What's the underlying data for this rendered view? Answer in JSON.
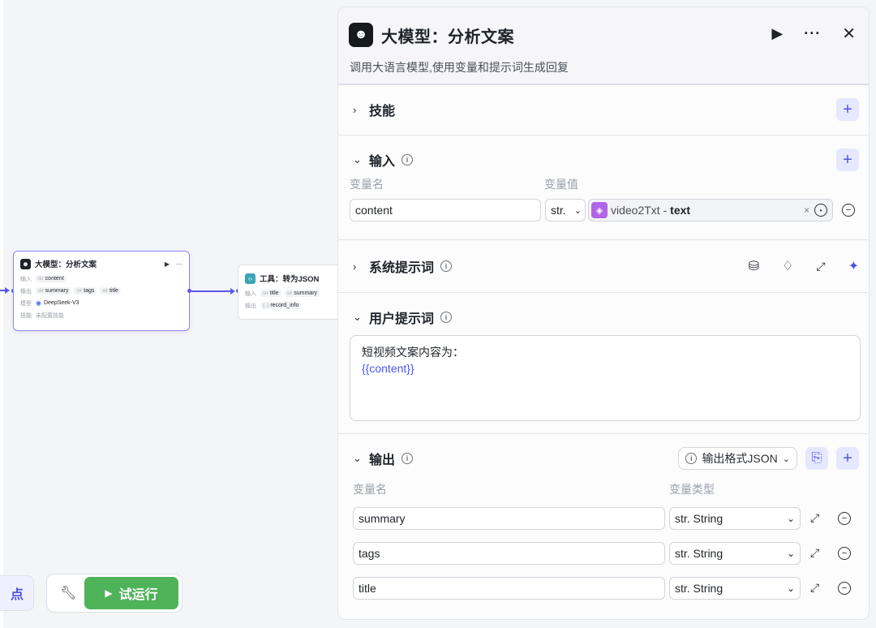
{
  "canvas": {
    "llm_node": {
      "title": "大模型：分析文案",
      "run_icon": "▶",
      "more_icon": "···",
      "input_key": "输入",
      "input_chip": {
        "type": "str",
        "name": "content"
      },
      "output_key": "输出",
      "output_chips": [
        {
          "type": "str",
          "name": "summary"
        },
        {
          "type": "str",
          "name": "tags"
        },
        {
          "type": "str",
          "name": "title"
        }
      ],
      "model_key": "模型",
      "model_value": "DeepSeek-V3",
      "skill_key": "技能",
      "skill_value": "未配置技能"
    },
    "tool_node": {
      "title": "工具：转为JSON",
      "input_key": "输入",
      "input_chips": [
        {
          "type": "str",
          "name": "title"
        },
        {
          "type": "str",
          "name": "summary"
        }
      ],
      "output_key": "输出",
      "output_chip": {
        "type": "{..}",
        "name": "record_info"
      }
    },
    "toolbar": {
      "add_node_fragment": "点",
      "run_label": "试运行",
      "run_icon": "▶"
    }
  },
  "panel": {
    "title": "大模型：分析文案",
    "description": "调用大语言模型,使用变量和提示词生成回复",
    "sections": {
      "skills": {
        "name": "技能"
      },
      "input": {
        "name": "输入",
        "col_name": "变量名",
        "col_value": "变量值",
        "rows": [
          {
            "name": "content",
            "type": "str.",
            "ref_node": "video2Txt",
            "ref_sep": " - ",
            "ref_field": "text"
          }
        ]
      },
      "system_prompt": {
        "name": "系统提示词"
      },
      "user_prompt": {
        "name": "用户提示词",
        "line1": "短视频文案内容为：",
        "line2": "{{content}}"
      },
      "output": {
        "name": "输出",
        "format_label": "输出格式JSON",
        "col_name": "变量名",
        "col_type": "变量类型",
        "rows": [
          {
            "name": "summary",
            "type": "str. String"
          },
          {
            "name": "tags",
            "type": "str. String"
          },
          {
            "name": "title",
            "type": "str. String"
          }
        ]
      }
    }
  },
  "colors": {
    "accent": "#4d53e8",
    "run_green": "#4fb35a",
    "node_border": "#8b87f5"
  }
}
